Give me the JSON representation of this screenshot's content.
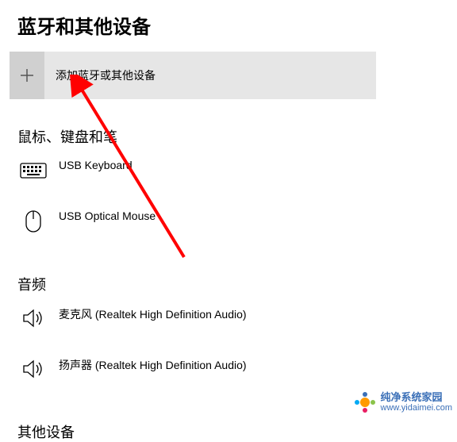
{
  "page": {
    "title": "蓝牙和其他设备"
  },
  "add_device": {
    "label": "添加蓝牙或其他设备"
  },
  "sections": {
    "mkp": {
      "header": "鼠标、键盘和笔"
    },
    "audio": {
      "header": "音频"
    },
    "other": {
      "header": "其他设备"
    }
  },
  "devices": {
    "keyboard": {
      "label": "USB Keyboard"
    },
    "mouse": {
      "label": "USB Optical Mouse"
    },
    "mic": {
      "label": "麦克风 (Realtek High Definition Audio)"
    },
    "speaker": {
      "label": "扬声器 (Realtek High Definition Audio)"
    }
  },
  "watermark": {
    "title": "纯净系统家园",
    "url": "www.yidaimei.com"
  },
  "annotation": {
    "arrow_color": "#ff0000"
  }
}
